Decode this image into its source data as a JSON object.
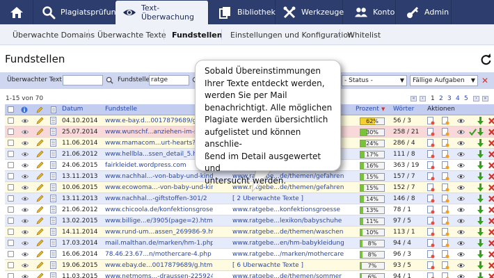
{
  "nav": {
    "tabs": [
      {
        "icon": "home-icon",
        "label": ""
      },
      {
        "icon": "search-icon",
        "label": "Plagiatsprüfung"
      },
      {
        "icon": "eye-icon",
        "label": "Text-Überwachung",
        "active": true
      },
      {
        "icon": "library-icon",
        "label": "Bibliothek"
      },
      {
        "icon": "tools-icon",
        "label": "Werkzeuge"
      },
      {
        "icon": "users-icon",
        "label": "Konto"
      },
      {
        "icon": "key-icon",
        "label": "Admin"
      }
    ]
  },
  "subnav": {
    "items": [
      {
        "label": "Überwachte Domains"
      },
      {
        "label": "Überwachte Texte"
      },
      {
        "label": "Fundstellen",
        "active": true
      },
      {
        "label": "Einstellungen und Konfiguration"
      },
      {
        "label": "Whitelist"
      }
    ]
  },
  "page": {
    "title": "Fundstellen"
  },
  "filter": {
    "text_label": "Überwachter Text",
    "text_value": "",
    "fund_label": "Fundstelle",
    "fund_value": "ratge",
    "status_select": "- Status -",
    "tasks_select": "Fällige Aufgaben"
  },
  "pagination": {
    "count_text": "1-15 von 70",
    "pages": [
      "1",
      "2",
      "3",
      "4",
      "5"
    ],
    "current": "1"
  },
  "table": {
    "headers": {
      "date": "Datum",
      "fund": "Fundstelle",
      "percent": "Prozent",
      "words": "Wörter",
      "actions": "Aktionen"
    },
    "rows": [
      {
        "date": "04.10.2014",
        "fund": "www.e-bay.d...0017879689/g.html",
        "url2": "",
        "percent": 62,
        "percent_label": "62%",
        "words": "56 / 3",
        "highlight": "yellow",
        "check": false
      },
      {
        "date": "25.07.2014",
        "fund": "www.wunschf...anziehen-im-sommer",
        "url2": "",
        "percent": 30,
        "percent_label": "30%",
        "words": "258 / 21",
        "highlight": "red",
        "check": true
      },
      {
        "date": "11.06.2014",
        "fund": "www.mamacom...urt-hearts?page=15",
        "url2": "",
        "percent": 24,
        "percent_label": "24%",
        "words": "286 / 4",
        "highlight": "yellow",
        "check": false
      },
      {
        "date": "21.06.2012",
        "fund": "www.hellbla...ssen_detail_5.htm",
        "url2": "",
        "percent": 17,
        "percent_label": "17%",
        "words": "111 / 8",
        "highlight": "blue",
        "check": false
      },
      {
        "date": "24.06.2015",
        "fund": "fairkleidet.wordpress.com",
        "url2": "",
        "percent": 16,
        "percent_label": "16%",
        "words": "363 / 19",
        "highlight": "white",
        "check": false
      },
      {
        "date": "13.11.2013",
        "fund": "www.nachhal...-von-baby-und-kind",
        "url2": "www.ratgebe...de/themen/gefahren",
        "percent": 15,
        "percent_label": "15%",
        "words": "157 / 7",
        "highlight": "blue",
        "check": false
      },
      {
        "date": "10.06.2015",
        "fund": "www.ecowoma...-von-baby-und-kind",
        "url2": "www.ratgebe...de/themen/gefahren",
        "percent": 15,
        "percent_label": "15%",
        "words": "152 / 7",
        "highlight": "yellow",
        "check": false
      },
      {
        "date": "13.11.2013",
        "fund": "www.nachhal...-giftstoffen-301/2",
        "url2": "[ 2 Überwachte Texte ]",
        "percent": 14,
        "percent_label": "14%",
        "words": "146 / 8",
        "highlight": "blue",
        "check": false
      },
      {
        "date": "21.06.2012",
        "fund": "www.chicoola.de/konfektionsgrosen",
        "url2": "www.ratgebe...konfektionsgroesse",
        "percent": 13,
        "percent_label": "13%",
        "words": "78 / 1",
        "highlight": "white",
        "check": false
      },
      {
        "date": "13.02.2015",
        "fund": "www.billige...e/3905(page=2).htm",
        "url2": "www.ratgebe...lexikon/babyschuhe",
        "percent": 11,
        "percent_label": "11%",
        "words": "97 / 5",
        "highlight": "blue",
        "check": false
      },
      {
        "date": "14.11.2014",
        "fund": "www.rund-um...assen_269986-9.htm",
        "url2": "www.ratgebe...de/themen/waschen",
        "percent": 10,
        "percent_label": "10%",
        "words": "113 / 1",
        "highlight": "yellow",
        "check": false
      },
      {
        "date": "17.03.2014",
        "fund": "mail.malthan.de/marken/hm-1.php",
        "url2": "www.ratgebe...en/hm-babykleidung",
        "percent": 8,
        "percent_label": "8%",
        "words": "94 / 4",
        "highlight": "blue",
        "check": false
      },
      {
        "date": "16.06.2014",
        "fund": "78.46.23.67...n/mothercare-4.php",
        "url2": "www.ratgebe.../marken/mothercare",
        "percent": 8,
        "percent_label": "8%",
        "words": "96 / 3",
        "highlight": "white",
        "check": false
      },
      {
        "date": "19.06.2015",
        "fund": "www.ebay.de...0017879689/g.html",
        "url2": "[ 6 Überwachte Texte ]",
        "percent": 7,
        "percent_label": "7%",
        "words": "93 / 5",
        "highlight": "yellow",
        "check": false
      },
      {
        "date": "11.03.2015",
        "fund": "www.netmoms...-draussen-22592462",
        "url2": "www.ratgebe...de/themen/sommer",
        "percent": 6,
        "percent_label": "6%",
        "words": "94 / 1",
        "highlight": "white",
        "check": false
      }
    ]
  },
  "tooltip": {
    "text": "Sobald Übereinstimmungen\nIhrer Texte entdeckt werden,\nwerden Sie per Mail\nbenachrichtigt. Alle möglichen\nPlagiate werden übersichtlich\naufgelistet und können anschlie-\nßend im Detail ausgewertet und\nuntersucht werden."
  },
  "colors": {
    "nav_bg": "#2d3e6e",
    "header_bg": "#c3cdf0",
    "row_yellow": "#fffbe0",
    "row_red": "#f8d8d8",
    "row_blue": "#e6ebfb",
    "row_white": "#ffffff",
    "bar_green": "#7ac13c",
    "bar_yellow": "#f3d02e",
    "delete_red": "#d3332b",
    "link_blue": "#2848a8"
  }
}
